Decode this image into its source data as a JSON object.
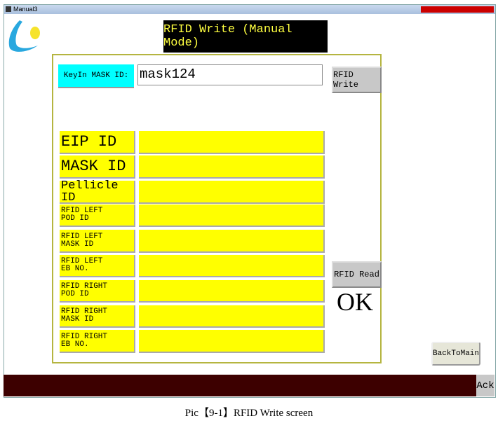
{
  "window": {
    "title": "Manual3"
  },
  "header": {
    "title": "RFID Write (Manual Mode)"
  },
  "keyin": {
    "label": "KeyIn MASK ID:",
    "value": "mask124"
  },
  "buttons": {
    "write": "RFID Write",
    "read": "RFID Read",
    "back": "BackToMain",
    "ack": "Ack"
  },
  "status": "OK",
  "fields": [
    {
      "l1": "EIP ID",
      "l2": ""
    },
    {
      "l1": "MASK ID",
      "l2": ""
    },
    {
      "l1": "Pellicle ID",
      "l2": ""
    },
    {
      "l1": "RFID LEFT",
      "l2": "POD ID"
    },
    {
      "l1": "RFID LEFT",
      "l2": "MASK ID"
    },
    {
      "l1": "RFID LEFT",
      "l2": "EB NO."
    },
    {
      "l1": "RFID RIGHT",
      "l2": "POD ID"
    },
    {
      "l1": "RFID RIGHT",
      "l2": "MASK ID"
    },
    {
      "l1": "RFID RIGHT",
      "l2": "EB NO."
    }
  ],
  "caption": "Pic【9-1】RFID  Write screen"
}
